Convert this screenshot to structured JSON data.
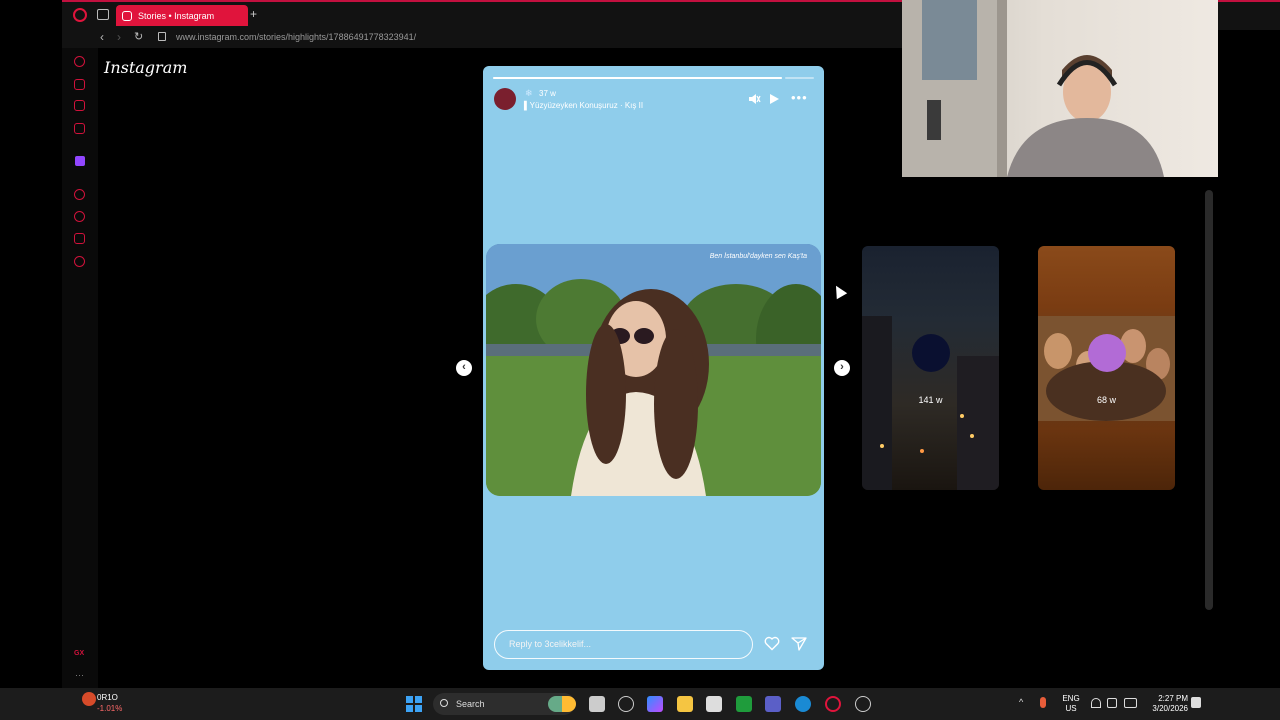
{
  "browser": {
    "tab_title": "Stories • Instagram",
    "url": "www.instagram.com/stories/highlights/17886491778323941/"
  },
  "instagram": {
    "logo": "Instagram"
  },
  "story": {
    "time": "37 w",
    "music": "Yüzyüzeyken Konuşuruz · Kış II",
    "photo_caption": "Ben İstanbul'dayken sen Kaş'ta",
    "reply_placeholder": "Reply to 3celikkelif...",
    "progress_segments": 10,
    "active_segment": 0,
    "active_progress": 0.9
  },
  "previews": [
    {
      "time": "141 w",
      "avatar_color": "#0a1030",
      "label": ""
    },
    {
      "time": "68 w",
      "avatar_color": "#b26bd6",
      "label": ""
    }
  ],
  "taskbar": {
    "ticker_name": "0R1O",
    "ticker_change": "-1.01%",
    "search_label": "Search",
    "language": "ENG",
    "region": "US",
    "time": "2:27 PM",
    "date": "3/20/2026"
  },
  "colors": {
    "opera_accent": "#e0143c",
    "story_background": "#8fcdeb"
  }
}
